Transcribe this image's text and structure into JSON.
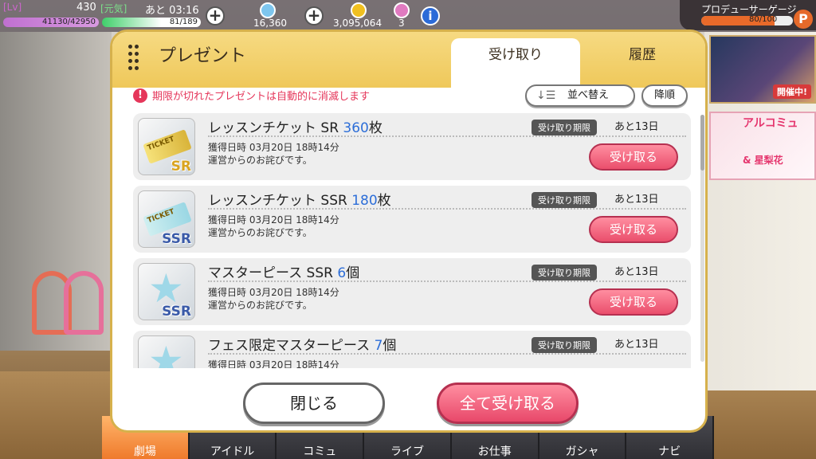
{
  "topbar": {
    "lv_label": "[Lv]",
    "lv": "430",
    "genki_label": "[元気]",
    "remaining": "あと 03:16",
    "exp": "41130/42950",
    "stamina": "81/189",
    "jewel": "16,360",
    "money": "3,095,064",
    "item": "3",
    "info_icon": "i"
  },
  "producer": {
    "label": "プロデューサーゲージ",
    "value": "80/100",
    "fill": 0.8,
    "icon": "P"
  },
  "banners": {
    "event_tag": "開催中!",
    "comm_title": "アルコミュ",
    "comm_sub": "& 星梨花"
  },
  "modal": {
    "title": "プレゼント",
    "tabs": [
      "受け取り",
      "履歴"
    ],
    "notice": "期限が切れたプレゼントは自動的に消滅します",
    "notice_icon": "!",
    "sort": "並べ替え",
    "order": "降順",
    "items": [
      {
        "name": "レッスンチケット SR ",
        "qty": "360",
        "unit": "枚",
        "deadline_tag": "受け取り期限",
        "deadline": "あと13日",
        "got": "獲得日時 03月20日 18時14分",
        "desc": "運営からのお詫びです。",
        "button": "受け取る",
        "rank": "SR",
        "ticket": "TICKET"
      },
      {
        "name": "レッスンチケット SSR ",
        "qty": "180",
        "unit": "枚",
        "deadline_tag": "受け取り期限",
        "deadline": "あと13日",
        "got": "獲得日時 03月20日 18時14分",
        "desc": "運営からのお詫びです。",
        "button": "受け取る",
        "rank": "SSR",
        "ticket": "TICKET"
      },
      {
        "name": "マスターピース SSR ",
        "qty": "6",
        "unit": "個",
        "deadline_tag": "受け取り期限",
        "deadline": "あと13日",
        "got": "獲得日時 03月20日 18時14分",
        "desc": "運営からのお詫びです。",
        "button": "受け取る",
        "rank": "SSR"
      },
      {
        "name": "フェス限定マスターピース ",
        "qty": "7",
        "unit": "個",
        "deadline_tag": "受け取り期限",
        "deadline": "あと13日",
        "got": "獲得日時 03月20日 18時14分",
        "desc": "",
        "button": "",
        "rank": ""
      }
    ],
    "close": "閉じる",
    "receive_all": "全て受け取る"
  },
  "nav": [
    "劇場",
    "アイドル",
    "コミュ",
    "ライブ",
    "お仕事",
    "ガシャ",
    "ナビ"
  ]
}
